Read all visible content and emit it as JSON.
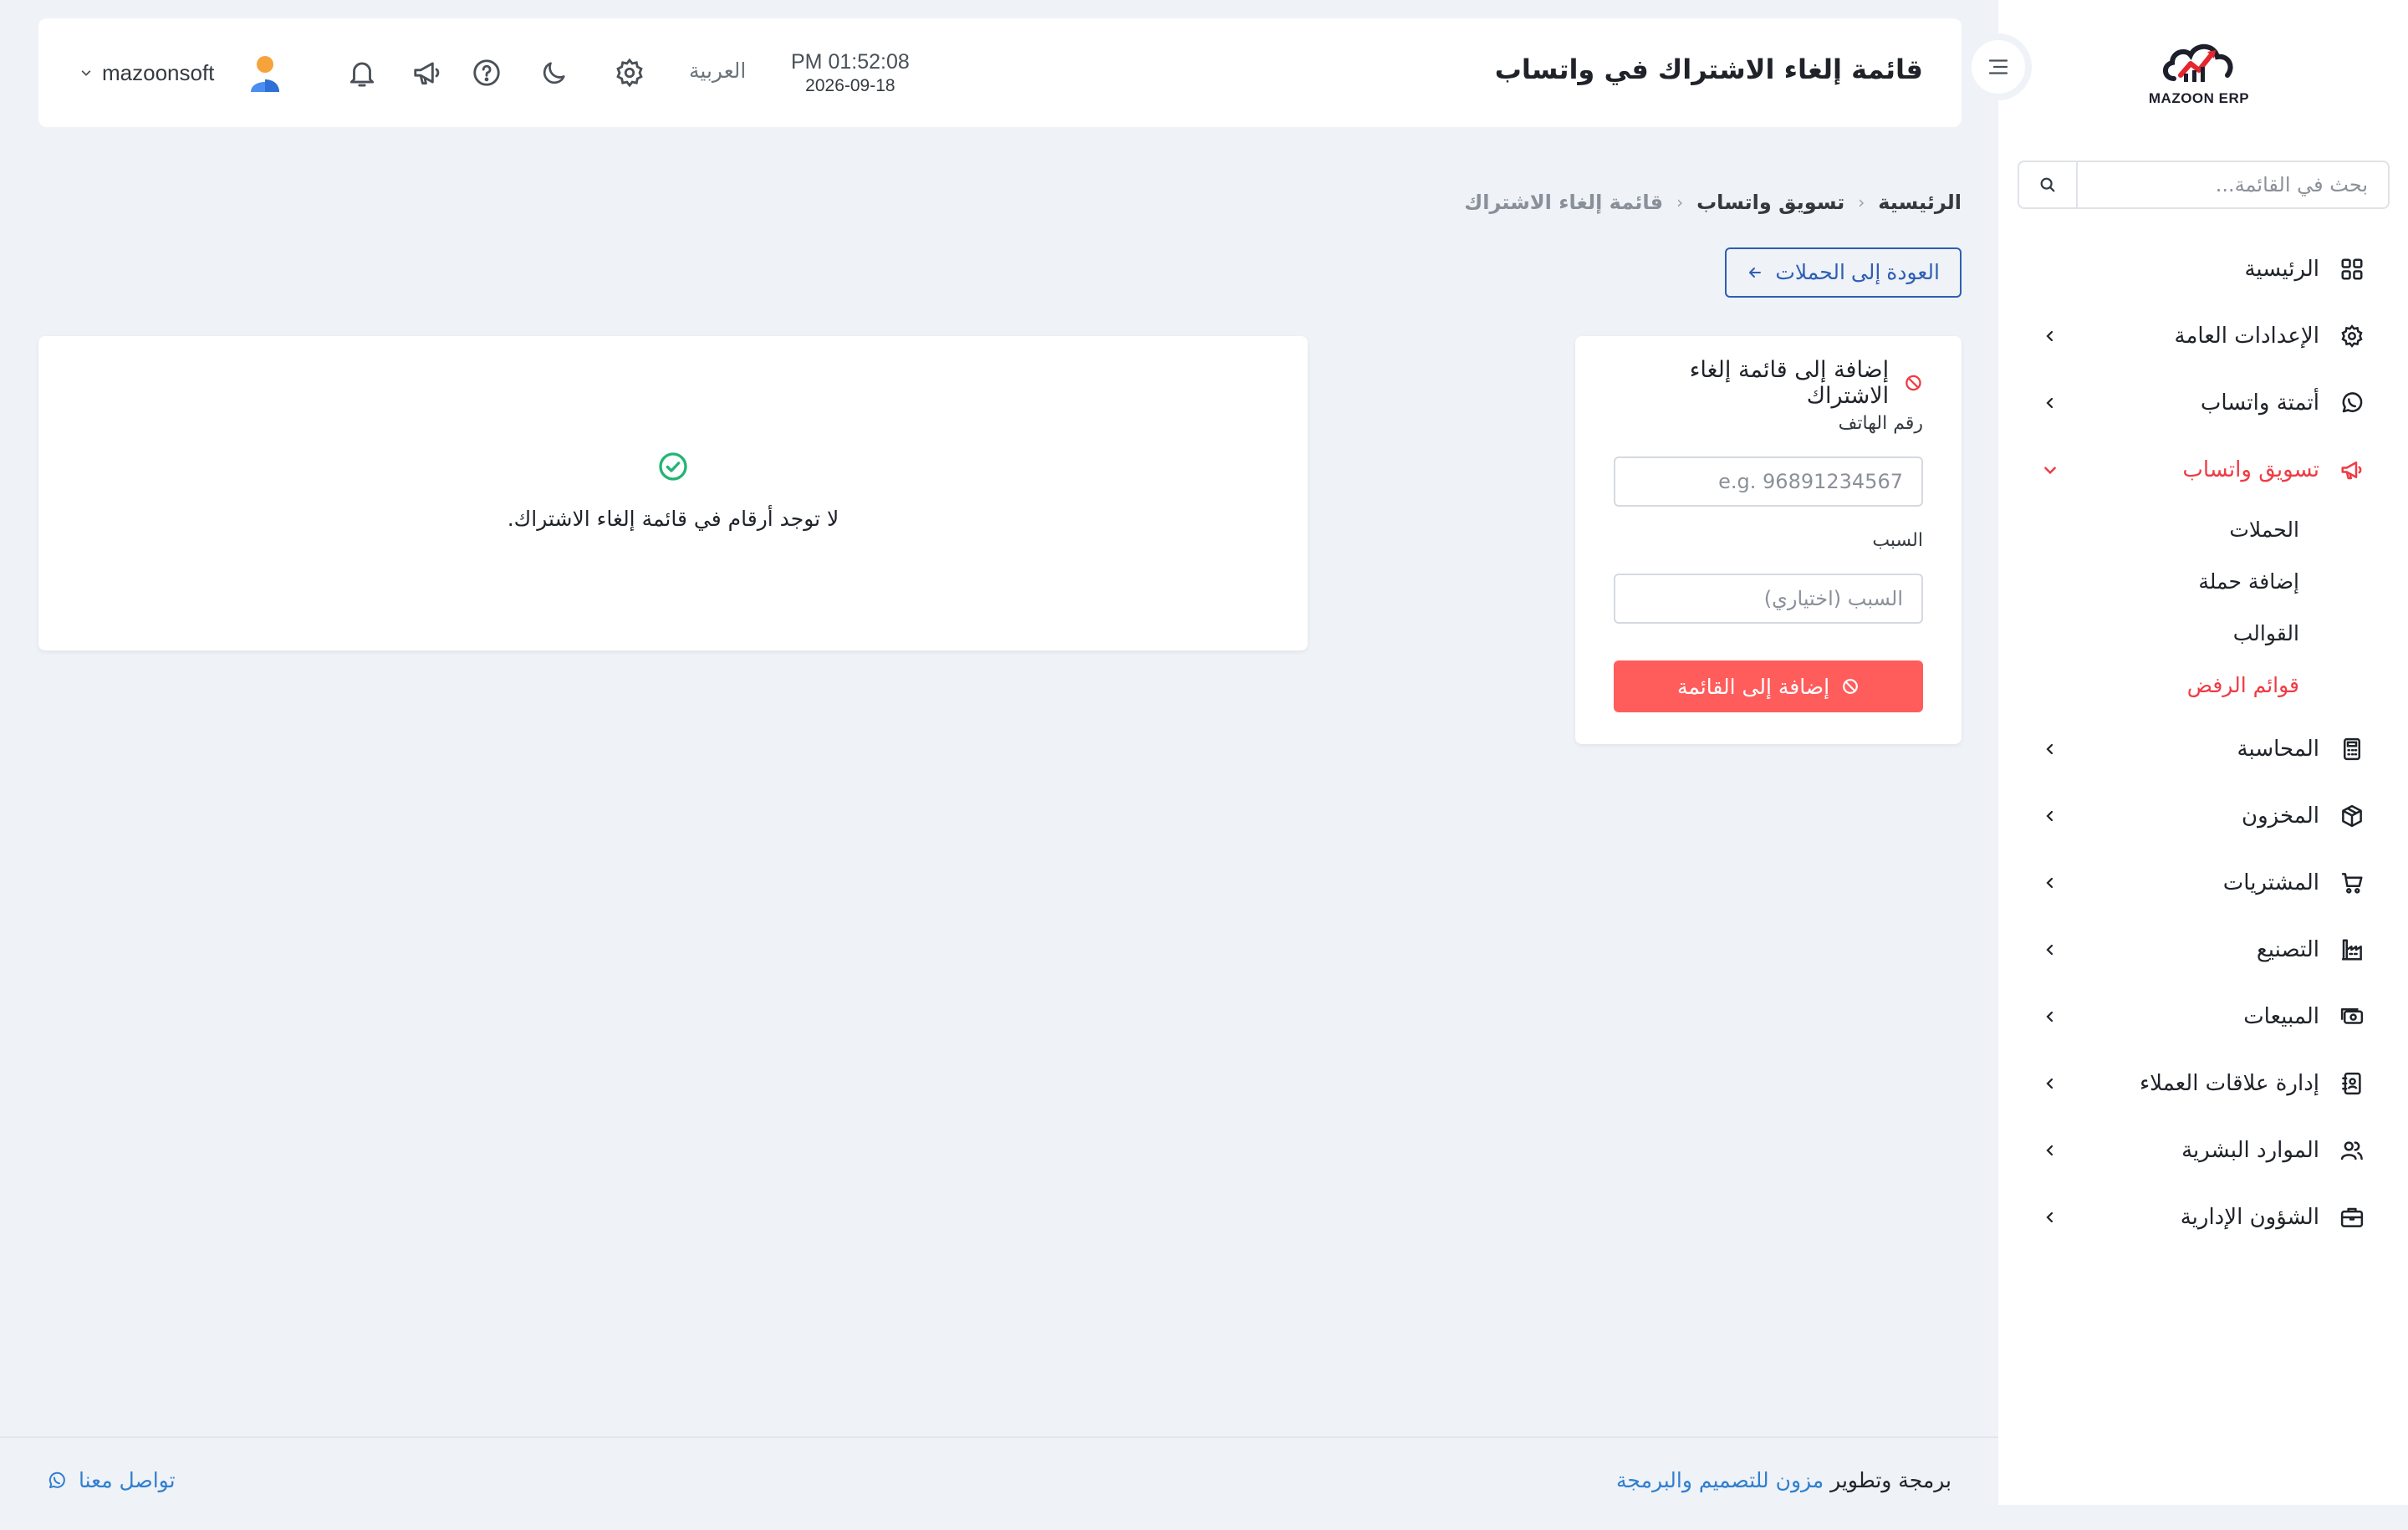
{
  "app": {
    "logo_text": "MAZOON ERP"
  },
  "sidebar": {
    "search_placeholder": "بحث في القائمة...",
    "items": [
      {
        "label": "الرئيسية",
        "icon": "grid-icon",
        "has_children": false
      },
      {
        "label": "الإعدادات العامة",
        "icon": "gear-icon",
        "has_children": true
      },
      {
        "label": "أتمتة واتساب",
        "icon": "whatsapp-icon",
        "has_children": true
      },
      {
        "label": "تسويق واتساب",
        "icon": "megaphone-icon",
        "has_children": true,
        "expanded": true,
        "active": true
      }
    ],
    "sub_items": [
      {
        "label": "الحملات",
        "active": false
      },
      {
        "label": "إضافة حملة",
        "active": false
      },
      {
        "label": "القوالب",
        "active": false
      },
      {
        "label": "قوائم الرفض",
        "active": true
      }
    ],
    "items_after": [
      {
        "label": "المحاسبة",
        "icon": "calculator-icon",
        "has_children": true
      },
      {
        "label": "المخزون",
        "icon": "box-icon",
        "has_children": true
      },
      {
        "label": "المشتريات",
        "icon": "cart-icon",
        "has_children": true
      },
      {
        "label": "التصنيع",
        "icon": "factory-icon",
        "has_children": true
      },
      {
        "label": "المبيعات",
        "icon": "cash-icon",
        "has_children": true
      },
      {
        "label": "إدارة علاقات العملاء",
        "icon": "contacts-icon",
        "has_children": true
      },
      {
        "label": "الموارد البشرية",
        "icon": "users-icon",
        "has_children": true
      },
      {
        "label": "الشؤون الإدارية",
        "icon": "briefcase-icon",
        "has_children": true
      }
    ]
  },
  "header": {
    "title": "قائمة إلغاء الاشتراك في واتساب",
    "time": "PM 01:52:08",
    "date": "2026-09-18",
    "language": "العربية",
    "username": "mazoonsoft"
  },
  "breadcrumb": {
    "home": "الرئيسية",
    "section": "تسويق واتساب",
    "current": "قائمة إلغاء الاشتراك"
  },
  "back_button": {
    "label": "العودة إلى الحملات"
  },
  "form": {
    "title": "إضافة إلى قائمة إلغاء الاشتراك",
    "phone_label": "رقم الهاتف",
    "phone_placeholder": "e.g. 96891234567",
    "phone_value": "",
    "reason_label": "السبب",
    "reason_placeholder": "السبب (اختياري)",
    "reason_value": "",
    "submit_label": "إضافة إلى القائمة"
  },
  "list": {
    "empty_message": "لا توجد أرقام في قائمة إلغاء الاشتراك."
  },
  "footer": {
    "credit_prefix": "برمجة وتطوير",
    "credit_link": "مزون للتصميم والبرمجة",
    "contact_label": "تواصل معنا"
  },
  "colors": {
    "accent_red": "#ef3b43",
    "button_red": "#ff5c5c",
    "primary_blue": "#2f5fb3",
    "link_blue": "#2f7fd0",
    "success_green": "#22b573",
    "background": "#eff2f6"
  }
}
